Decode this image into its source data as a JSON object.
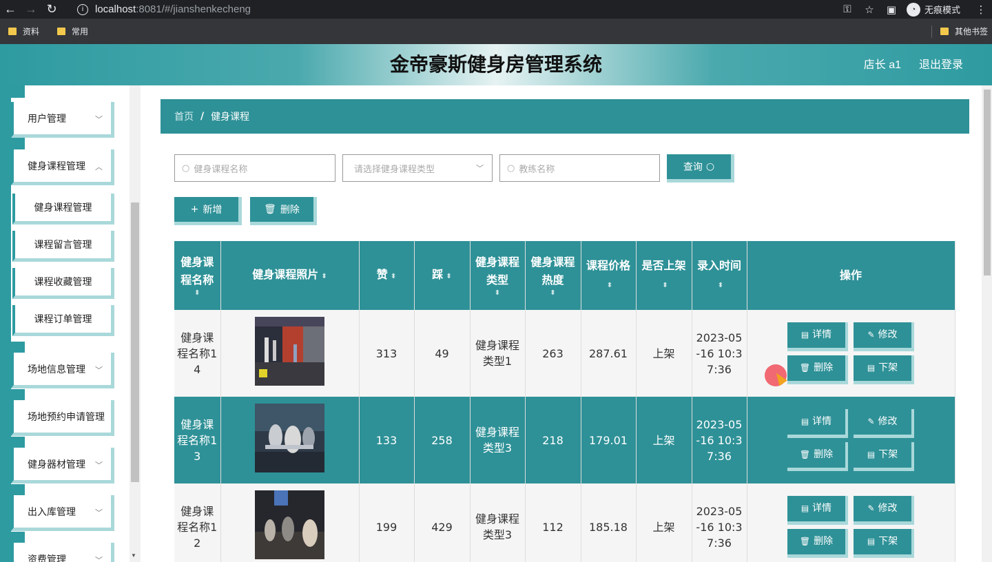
{
  "browser": {
    "url_host": "localhost",
    "url_rest": ":8081/#/jianshenkecheng",
    "incognito_label": "无痕模式",
    "bookmarks": [
      "资料",
      "常用"
    ],
    "other_bookmarks": "其他书签"
  },
  "header": {
    "title": "金帝豪斯健身房管理系统",
    "user": "店长 a1",
    "logout": "退出登录"
  },
  "sidebar": {
    "menus": [
      {
        "label": "用户管理"
      },
      {
        "label": "健身课程管理"
      },
      {
        "label": "场地信息管理"
      },
      {
        "label": "场地预约申请管理"
      },
      {
        "label": "健身器材管理"
      },
      {
        "label": "出入库管理"
      },
      {
        "label": "资费管理"
      }
    ],
    "submenus": [
      "健身课程管理",
      "课程留言管理",
      "课程收藏管理",
      "课程订单管理"
    ]
  },
  "breadcrumb": {
    "home": "首页",
    "separator": "/",
    "current": "健身课程"
  },
  "search": {
    "name_placeholder": "健身课程名称",
    "type_placeholder": "请选择健身课程类型",
    "coach_placeholder": "教练名称",
    "query_label": "查询"
  },
  "toolbar": {
    "add_label": "新增",
    "delete_label": "删除"
  },
  "table": {
    "headers": {
      "name": "健身课程名称",
      "photo": "健身课程照片",
      "like": "赞",
      "dislike": "踩",
      "type": "健身课程类型",
      "heat": "健身课程热度",
      "price": "课程价格",
      "onsale": "是否上架",
      "time": "录入时间",
      "ops": "操作"
    },
    "rows": [
      {
        "name": "健身课程名称14",
        "like": "313",
        "dislike": "49",
        "type": "健身课程类型1",
        "heat": "263",
        "price": "287.61",
        "onsale": "上架",
        "time": "2023-05-16 10:37:36"
      },
      {
        "name": "健身课程名称13",
        "like": "133",
        "dislike": "258",
        "type": "健身课程类型3",
        "heat": "218",
        "price": "179.01",
        "onsale": "上架",
        "time": "2023-05-16 10:37:36"
      },
      {
        "name": "健身课程名称12",
        "like": "199",
        "dislike": "429",
        "type": "健身课程类型3",
        "heat": "112",
        "price": "185.18",
        "onsale": "上架",
        "time": "2023-05-16 10:37:36"
      }
    ],
    "op_labels": {
      "detail": "详情",
      "edit": "修改",
      "delete": "删除",
      "offshelf": "下架"
    }
  },
  "colors": {
    "primary": "#2e9197",
    "accent": "#a9d8da"
  }
}
